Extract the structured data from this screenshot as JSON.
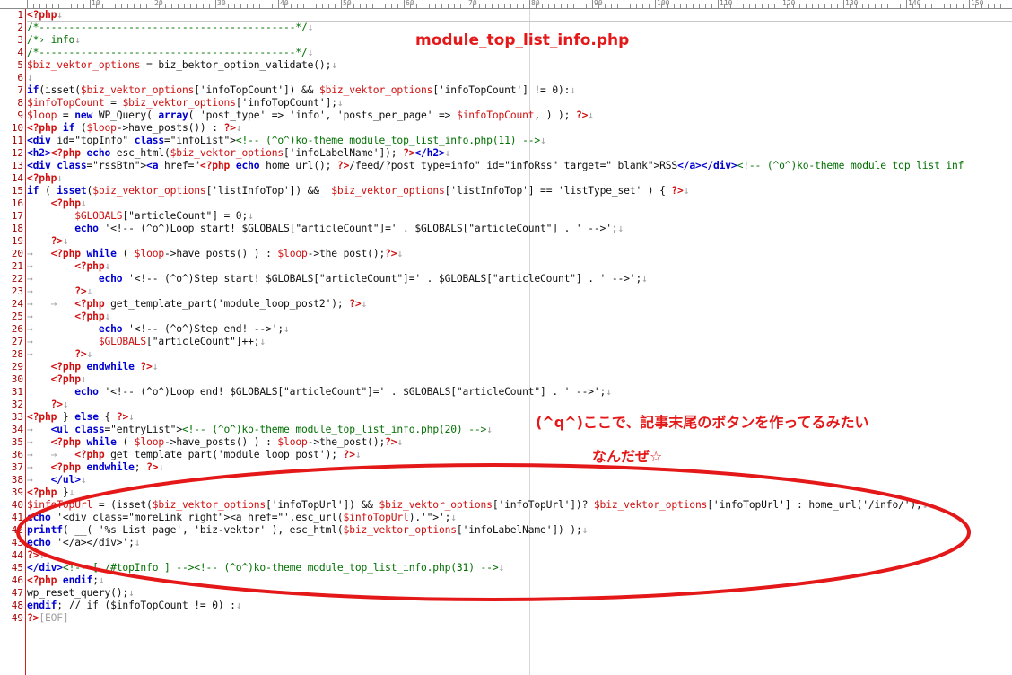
{
  "ruler": {
    "labels": [
      "10",
      "20",
      "30",
      "40",
      "50",
      "60",
      "70",
      "80",
      "90",
      "100",
      "110",
      "120",
      "130",
      "140",
      "150"
    ]
  },
  "annotations": {
    "filename": "module_top_list_info.php",
    "note_line1": "(^q^)ここで、記事末尾のボタンを作ってるみたい",
    "note_line2": "なんだぜ☆",
    "accent_color": "#e41818"
  },
  "editor": {
    "lines": [
      {
        "n": "1",
        "segs": [
          [
            "php",
            "<?php"
          ],
          [
            "dim",
            "↓"
          ]
        ]
      },
      {
        "n": "2",
        "segs": [
          [
            "com",
            "/*-------------------------------------------*/"
          ],
          [
            "dim",
            "↓"
          ]
        ]
      },
      {
        "n": "3",
        "segs": [
          [
            "com",
            "/*› info"
          ],
          [
            "dim",
            "↓"
          ]
        ]
      },
      {
        "n": "4",
        "segs": [
          [
            "com",
            "/*-------------------------------------------*/"
          ],
          [
            "dim",
            "↓"
          ]
        ]
      },
      {
        "n": "5",
        "segs": [
          [
            "var",
            "$biz_vektor_options"
          ],
          [
            "pl",
            " = biz_bektor_option_validate();"
          ],
          [
            "dim",
            "↓"
          ]
        ]
      },
      {
        "n": "6",
        "segs": [
          [
            "dim",
            "↓"
          ]
        ]
      },
      {
        "n": "7",
        "segs": [
          [
            "kw",
            "if"
          ],
          [
            "pl",
            "(isset("
          ],
          [
            "var",
            "$biz_vektor_options"
          ],
          [
            "pl",
            "['infoTopCount']) && "
          ],
          [
            "var",
            "$biz_vektor_options"
          ],
          [
            "pl",
            "['infoTopCount'] != 0):"
          ],
          [
            "dim",
            "↓"
          ]
        ]
      },
      {
        "n": "8",
        "segs": [
          [
            "var",
            "$infoTopCount"
          ],
          [
            "pl",
            " = "
          ],
          [
            "var",
            "$biz_vektor_options"
          ],
          [
            "pl",
            "['infoTopCount'];"
          ],
          [
            "dim",
            "↓"
          ]
        ]
      },
      {
        "n": "9",
        "segs": [
          [
            "var",
            "$loop"
          ],
          [
            "pl",
            " = "
          ],
          [
            "kw",
            "new"
          ],
          [
            "pl",
            " WP_Query( "
          ],
          [
            "kw",
            "array"
          ],
          [
            "pl",
            "( 'post_type' => 'info', 'posts_per_page' => "
          ],
          [
            "var",
            "$infoTopCount"
          ],
          [
            "pl",
            ", ) ); "
          ],
          [
            "php",
            "?>"
          ],
          [
            "dim",
            "↓"
          ]
        ]
      },
      {
        "n": "10",
        "segs": [
          [
            "php",
            "<?php"
          ],
          [
            "pl",
            " "
          ],
          [
            "kw",
            "if"
          ],
          [
            "pl",
            " ("
          ],
          [
            "var",
            "$loop"
          ],
          [
            "pl",
            "->have_posts()) : "
          ],
          [
            "php",
            "?>"
          ],
          [
            "dim",
            "↓"
          ]
        ]
      },
      {
        "n": "11",
        "segs": [
          [
            "tag",
            "<div"
          ],
          [
            "pl",
            " id=\"topInfo\" "
          ],
          [
            "tag",
            "class"
          ],
          [
            "pl",
            "=\"infoList\">"
          ],
          [
            "com",
            "<!-- (^o^)ko-theme module_top_list_info.php(11) -->"
          ],
          [
            "dim",
            "↓"
          ]
        ]
      },
      {
        "n": "12",
        "segs": [
          [
            "tag",
            "<h2>"
          ],
          [
            "php",
            "<?php"
          ],
          [
            "pl",
            " "
          ],
          [
            "kw",
            "echo"
          ],
          [
            "pl",
            " esc_html("
          ],
          [
            "var",
            "$biz_vektor_options"
          ],
          [
            "pl",
            "['infoLabelName']); "
          ],
          [
            "php",
            "?>"
          ],
          [
            "tag",
            "</h2>"
          ],
          [
            "dim",
            "↓"
          ]
        ]
      },
      {
        "n": "13",
        "segs": [
          [
            "tag",
            "<div"
          ],
          [
            "pl",
            " "
          ],
          [
            "tag",
            "class"
          ],
          [
            "pl",
            "=\"rssBtn\">"
          ],
          [
            "tag",
            "<a"
          ],
          [
            "pl",
            " href=\""
          ],
          [
            "php",
            "<?php"
          ],
          [
            "pl",
            " "
          ],
          [
            "kw",
            "echo"
          ],
          [
            "pl",
            " home_url(); "
          ],
          [
            "php",
            "?>"
          ],
          [
            "pl",
            "/feed/?post_type=info\" id=\"infoRss\" target=\"_blank\">RSS"
          ],
          [
            "tag",
            "</a></div>"
          ],
          [
            "com",
            "<!-- (^o^)ko-theme module_top_list_inf"
          ]
        ]
      },
      {
        "n": "14",
        "segs": [
          [
            "php",
            "<?php"
          ],
          [
            "dim",
            "↓"
          ]
        ]
      },
      {
        "n": "15",
        "segs": [
          [
            "kw",
            "if"
          ],
          [
            "pl",
            " ( "
          ],
          [
            "kw",
            "isset"
          ],
          [
            "pl",
            "("
          ],
          [
            "var",
            "$biz_vektor_options"
          ],
          [
            "pl",
            "['listInfoTop']) &&  "
          ],
          [
            "var",
            "$biz_vektor_options"
          ],
          [
            "pl",
            "['listInfoTop'] == 'listType_set' ) { "
          ],
          [
            "php",
            "?>"
          ],
          [
            "dim",
            "↓"
          ]
        ]
      },
      {
        "n": "16",
        "segs": [
          [
            "pl",
            "    "
          ],
          [
            "php",
            "<?php"
          ],
          [
            "dim",
            "↓"
          ]
        ]
      },
      {
        "n": "17",
        "segs": [
          [
            "pl",
            "        "
          ],
          [
            "var",
            "$GLOBALS"
          ],
          [
            "pl",
            "[\"articleCount\"] = 0;"
          ],
          [
            "dim",
            "↓"
          ]
        ]
      },
      {
        "n": "18",
        "segs": [
          [
            "pl",
            "        "
          ],
          [
            "kw",
            "echo"
          ],
          [
            "pl",
            " '<!-- (^o^)Loop start! $GLOBALS[\"articleCount\"]=' . $GLOBALS[\"articleCount\"] . ' -->';"
          ],
          [
            "dim",
            "↓"
          ]
        ]
      },
      {
        "n": "19",
        "segs": [
          [
            "pl",
            "    "
          ],
          [
            "php",
            "?>"
          ],
          [
            "dim",
            "↓"
          ]
        ]
      },
      {
        "n": "20",
        "segs": [
          [
            "dim",
            "→   "
          ],
          [
            "php",
            "<?php"
          ],
          [
            "pl",
            " "
          ],
          [
            "kw",
            "while"
          ],
          [
            "pl",
            " ( "
          ],
          [
            "var",
            "$loop"
          ],
          [
            "pl",
            "->have_posts() ) : "
          ],
          [
            "var",
            "$loop"
          ],
          [
            "pl",
            "->the_post();"
          ],
          [
            "php",
            "?>"
          ],
          [
            "dim",
            "↓"
          ]
        ]
      },
      {
        "n": "21",
        "segs": [
          [
            "dim",
            "→       "
          ],
          [
            "php",
            "<?php"
          ],
          [
            "dim",
            "↓"
          ]
        ]
      },
      {
        "n": "22",
        "segs": [
          [
            "dim",
            "→           "
          ],
          [
            "kw",
            "echo"
          ],
          [
            "pl",
            " '<!-- (^o^)Step start! $GLOBALS[\"articleCount\"]=' . $GLOBALS[\"articleCount\"] . ' -->';"
          ],
          [
            "dim",
            "↓"
          ]
        ]
      },
      {
        "n": "23",
        "segs": [
          [
            "dim",
            "→       "
          ],
          [
            "php",
            "?>"
          ],
          [
            "dim",
            "↓"
          ]
        ]
      },
      {
        "n": "24",
        "segs": [
          [
            "dim",
            "→   →   "
          ],
          [
            "php",
            "<?php"
          ],
          [
            "pl",
            " get_template_part('module_loop_post2'); "
          ],
          [
            "php",
            "?>"
          ],
          [
            "dim",
            "↓"
          ]
        ]
      },
      {
        "n": "25",
        "segs": [
          [
            "dim",
            "→       "
          ],
          [
            "php",
            "<?php"
          ],
          [
            "dim",
            "↓"
          ]
        ]
      },
      {
        "n": "26",
        "segs": [
          [
            "dim",
            "→           "
          ],
          [
            "kw",
            "echo"
          ],
          [
            "pl",
            " '<!-- (^o^)Step end! -->';"
          ],
          [
            "dim",
            "↓"
          ]
        ]
      },
      {
        "n": "27",
        "segs": [
          [
            "dim",
            "→           "
          ],
          [
            "var",
            "$GLOBALS"
          ],
          [
            "pl",
            "[\"articleCount\"]++;"
          ],
          [
            "dim",
            "↓"
          ]
        ]
      },
      {
        "n": "28",
        "segs": [
          [
            "dim",
            "→       "
          ],
          [
            "php",
            "?>"
          ],
          [
            "dim",
            "↓"
          ]
        ]
      },
      {
        "n": "29",
        "segs": [
          [
            "pl",
            "    "
          ],
          [
            "php",
            "<?php"
          ],
          [
            "pl",
            " "
          ],
          [
            "kw",
            "endwhile"
          ],
          [
            "pl",
            " "
          ],
          [
            "php",
            "?>"
          ],
          [
            "dim",
            "↓"
          ]
        ]
      },
      {
        "n": "30",
        "segs": [
          [
            "pl",
            "    "
          ],
          [
            "php",
            "<?php"
          ],
          [
            "dim",
            "↓"
          ]
        ]
      },
      {
        "n": "31",
        "segs": [
          [
            "pl",
            "        "
          ],
          [
            "kw",
            "echo"
          ],
          [
            "pl",
            " '<!-- (^o^)Loop end! $GLOBALS[\"articleCount\"]=' . $GLOBALS[\"articleCount\"] . ' -->';"
          ],
          [
            "dim",
            "↓"
          ]
        ]
      },
      {
        "n": "32",
        "segs": [
          [
            "pl",
            "    "
          ],
          [
            "php",
            "?>"
          ],
          [
            "dim",
            "↓"
          ]
        ]
      },
      {
        "n": "33",
        "segs": [
          [
            "php",
            "<?php"
          ],
          [
            "pl",
            " } "
          ],
          [
            "kw",
            "else"
          ],
          [
            "pl",
            " { "
          ],
          [
            "php",
            "?>"
          ],
          [
            "dim",
            "↓"
          ]
        ]
      },
      {
        "n": "34",
        "segs": [
          [
            "dim",
            "→   "
          ],
          [
            "tag",
            "<ul"
          ],
          [
            "pl",
            " "
          ],
          [
            "tag",
            "class"
          ],
          [
            "pl",
            "=\"entryList\">"
          ],
          [
            "com",
            "<!-- (^o^)ko-theme module_top_list_info.php(20) -->"
          ],
          [
            "dim",
            "↓"
          ]
        ]
      },
      {
        "n": "35",
        "segs": [
          [
            "dim",
            "→   "
          ],
          [
            "php",
            "<?php"
          ],
          [
            "pl",
            " "
          ],
          [
            "kw",
            "while"
          ],
          [
            "pl",
            " ( "
          ],
          [
            "var",
            "$loop"
          ],
          [
            "pl",
            "->have_posts() ) : "
          ],
          [
            "var",
            "$loop"
          ],
          [
            "pl",
            "->the_post();"
          ],
          [
            "php",
            "?>"
          ],
          [
            "dim",
            "↓"
          ]
        ]
      },
      {
        "n": "36",
        "segs": [
          [
            "dim",
            "→   →   "
          ],
          [
            "php",
            "<?php"
          ],
          [
            "pl",
            " get_template_part('module_loop_post'); "
          ],
          [
            "php",
            "?>"
          ],
          [
            "dim",
            "↓"
          ]
        ]
      },
      {
        "n": "37",
        "segs": [
          [
            "dim",
            "→   "
          ],
          [
            "php",
            "<?php"
          ],
          [
            "pl",
            " "
          ],
          [
            "kw",
            "endwhile"
          ],
          [
            "pl",
            "; "
          ],
          [
            "php",
            "?>"
          ],
          [
            "dim",
            "↓"
          ]
        ]
      },
      {
        "n": "38",
        "segs": [
          [
            "dim",
            "→   "
          ],
          [
            "tag",
            "</ul>"
          ],
          [
            "dim",
            "↓"
          ]
        ]
      },
      {
        "n": "39",
        "segs": [
          [
            "php",
            "<?php"
          ],
          [
            "pl",
            " }"
          ],
          [
            "dim",
            "↓"
          ]
        ]
      },
      {
        "n": "40",
        "segs": [
          [
            "var",
            "$infoTopUrl"
          ],
          [
            "pl",
            " = (isset("
          ],
          [
            "var",
            "$biz_vektor_options"
          ],
          [
            "pl",
            "['infoTopUrl']) && "
          ],
          [
            "var",
            "$biz_vektor_options"
          ],
          [
            "pl",
            "['infoTopUrl'])? "
          ],
          [
            "var",
            "$biz_vektor_options"
          ],
          [
            "pl",
            "['infoTopUrl'] : home_url('/info/');"
          ],
          [
            "dim",
            "↓"
          ]
        ]
      },
      {
        "n": "41",
        "segs": [
          [
            "kw",
            "echo"
          ],
          [
            "pl",
            " '<div class=\"moreLink right\"><a href=\"'.esc_url("
          ],
          [
            "var",
            "$infoTopUrl"
          ],
          [
            "pl",
            ").'\">';"
          ],
          [
            "dim",
            "↓"
          ]
        ]
      },
      {
        "n": "42",
        "segs": [
          [
            "kw",
            "printf"
          ],
          [
            "pl",
            "( __( '%s List page', 'biz-vektor' ), esc_html("
          ],
          [
            "var",
            "$biz_vektor_options"
          ],
          [
            "pl",
            "['infoLabelName']) );"
          ],
          [
            "dim",
            "↓"
          ]
        ]
      },
      {
        "n": "43",
        "segs": [
          [
            "kw",
            "echo"
          ],
          [
            "pl",
            " '</a></div>';"
          ],
          [
            "dim",
            "↓"
          ]
        ]
      },
      {
        "n": "44",
        "segs": [
          [
            "php",
            "?>"
          ],
          [
            "dim",
            "↓"
          ]
        ]
      },
      {
        "n": "45",
        "segs": [
          [
            "tag",
            "</div>"
          ],
          [
            "com",
            "<!-- [ /#topInfo ] --><!-- (^o^)ko-theme module_top_list_info.php(31) -->"
          ],
          [
            "dim",
            "↓"
          ]
        ]
      },
      {
        "n": "46",
        "segs": [
          [
            "php",
            "<?php"
          ],
          [
            "pl",
            " "
          ],
          [
            "kw",
            "endif"
          ],
          [
            "pl",
            ";"
          ],
          [
            "dim",
            "↓"
          ]
        ]
      },
      {
        "n": "47",
        "segs": [
          [
            "pl",
            "wp_reset_query();"
          ],
          [
            "dim",
            "↓"
          ]
        ]
      },
      {
        "n": "48",
        "segs": [
          [
            "kw",
            "endif"
          ],
          [
            "pl",
            "; // if ($infoTopCount != 0) :"
          ],
          [
            "dim",
            "↓"
          ]
        ]
      },
      {
        "n": "49",
        "segs": [
          [
            "php",
            "?>"
          ],
          [
            "eof",
            "[EOF]"
          ]
        ]
      }
    ]
  }
}
